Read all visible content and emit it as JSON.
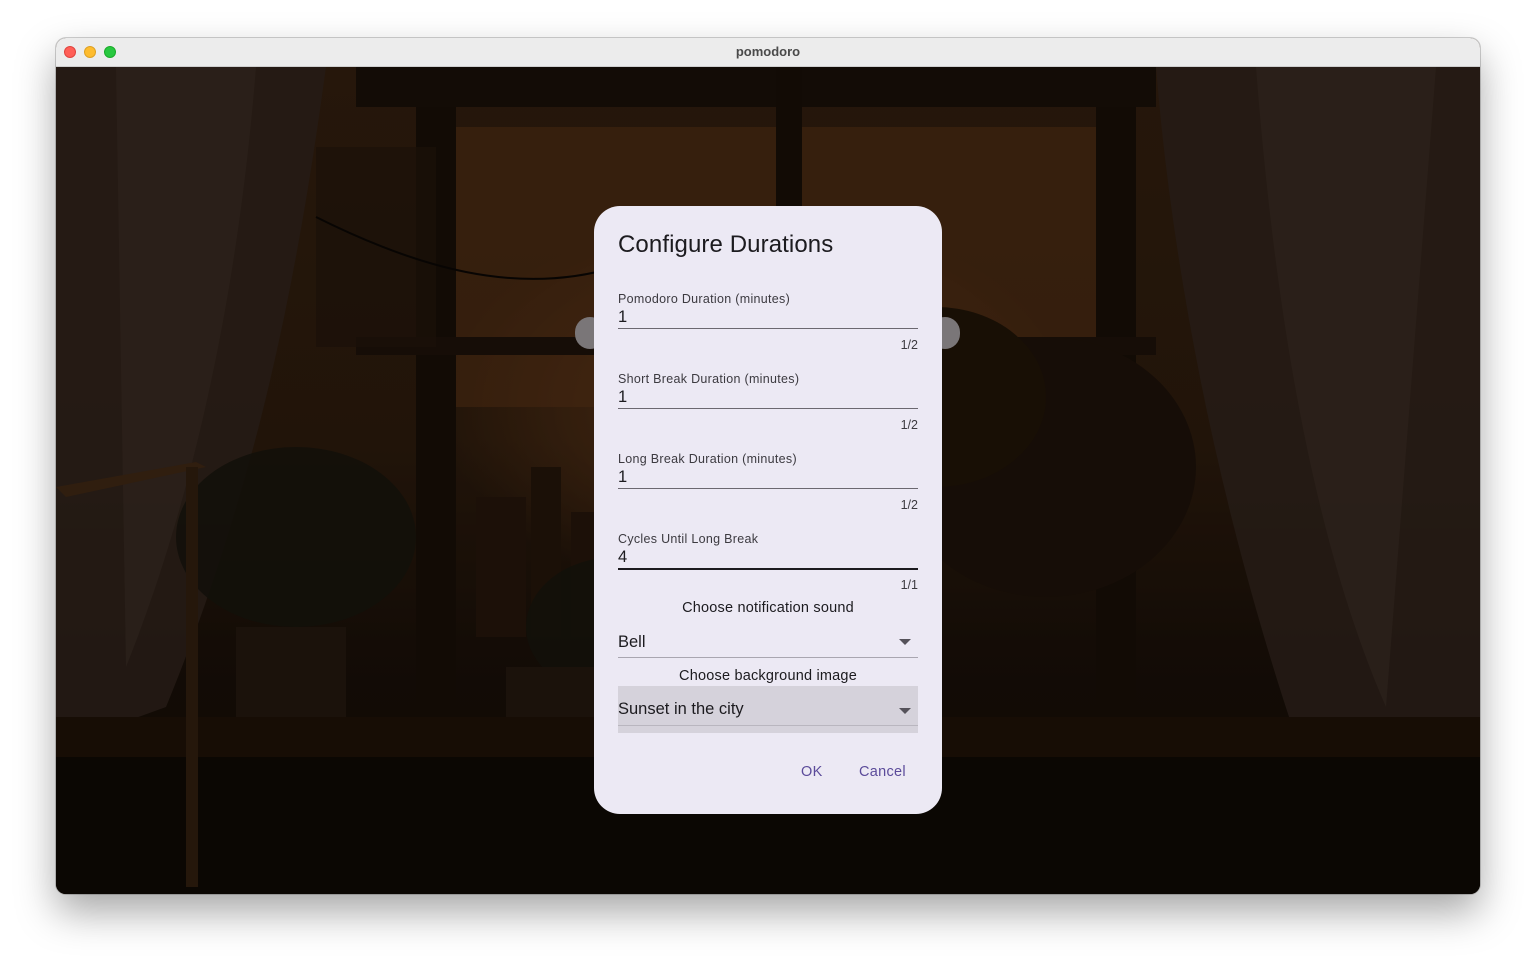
{
  "window": {
    "title": "pomodoro"
  },
  "dialog": {
    "title": "Configure Durations",
    "fields": [
      {
        "label": "Pomodoro Duration (minutes)",
        "value": "1",
        "counter": "1/2"
      },
      {
        "label": "Short Break Duration (minutes)",
        "value": "1",
        "counter": "1/2"
      },
      {
        "label": "Long Break Duration (minutes)",
        "value": "1",
        "counter": "1/2"
      },
      {
        "label": "Cycles Until Long Break",
        "value": "4",
        "counter": "1/1"
      }
    ],
    "notification_sound": {
      "label": "Choose notification sound",
      "selected": "Bell"
    },
    "background_image": {
      "label": "Choose background image",
      "selected": "Sunset in the city"
    },
    "buttons": {
      "ok": "OK",
      "cancel": "Cancel"
    }
  },
  "colors": {
    "dialog_background": "#ece9f4",
    "accent": "#5b4b9a",
    "close": "#ff5f57",
    "minimize": "#febc2e",
    "maximize": "#28c840"
  }
}
